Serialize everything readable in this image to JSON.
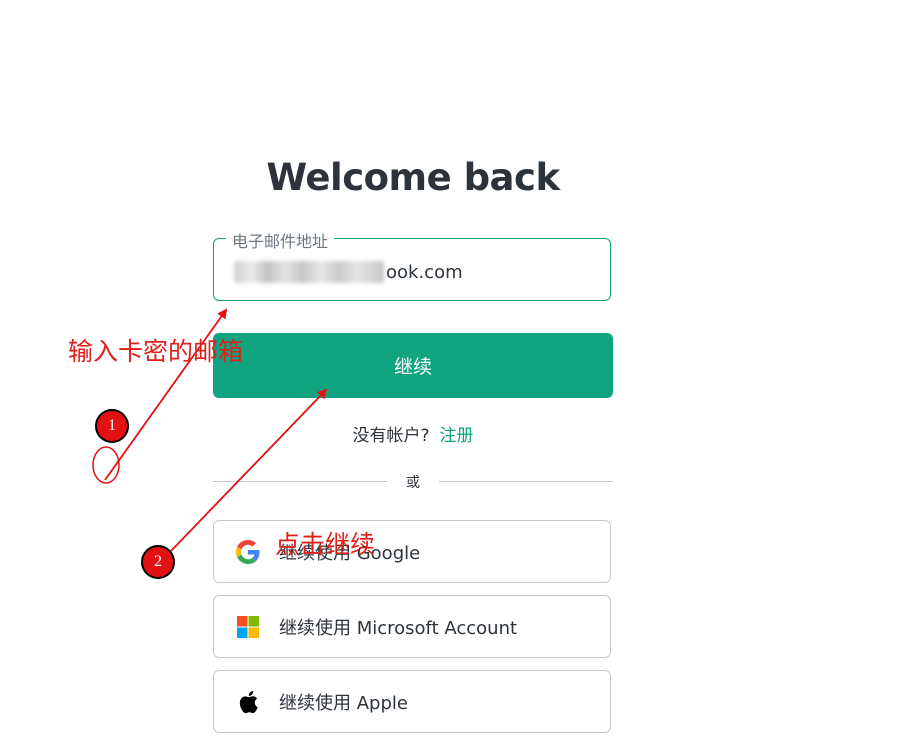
{
  "login": {
    "title": "Welcome back",
    "email": {
      "label": "电子邮件地址",
      "value_suffix": "ook.com"
    },
    "continue_label": "继续",
    "signup": {
      "prompt": "没有帐户?",
      "link": "注册"
    },
    "divider": "或",
    "social": {
      "google": "继续使用 Google",
      "microsoft": "继续使用 Microsoft Account",
      "apple": "继续使用 Apple"
    }
  },
  "annotations": {
    "step1_text": "输入卡密的邮箱",
    "step2_text": "点击继续",
    "badge1": "1",
    "badge2": "2",
    "color": "#e0201a"
  },
  "colors": {
    "accent": "#10a37f",
    "border": "#c2c8d0",
    "text": "#2d333a"
  }
}
